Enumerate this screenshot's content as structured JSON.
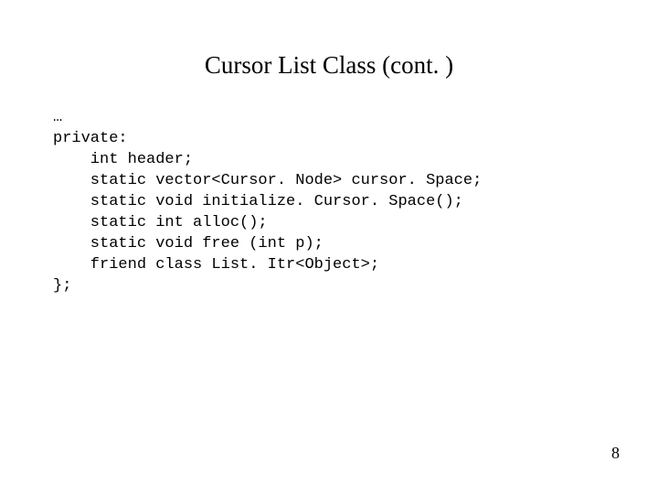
{
  "title": "Cursor List Class (cont. )",
  "code": {
    "l1": "…",
    "l2": "private:",
    "l3": "    int header;",
    "l4": "    static vector<Cursor. Node> cursor. Space;",
    "l5": "    static void initialize. Cursor. Space();",
    "l6": "    static int alloc();",
    "l7": "    static void free (int p);",
    "l8": "    friend class List. Itr<Object>;",
    "l9": "};"
  },
  "page_number": "8"
}
